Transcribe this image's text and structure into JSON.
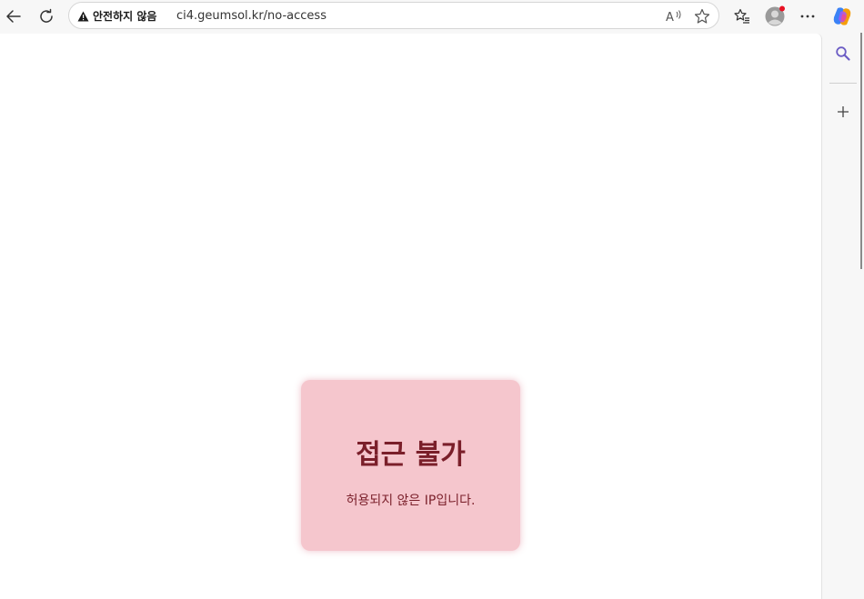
{
  "browser": {
    "security_label": "안전하지 않음",
    "url": "ci4.geumsol.kr/no-access",
    "icons": {
      "back": "back-arrow-icon",
      "refresh": "refresh-icon",
      "warning": "warning-triangle-icon",
      "read_aloud": "read-aloud-icon",
      "favorite": "star-icon",
      "favorites": "favorites-list-icon",
      "profile": "profile-avatar-icon",
      "more": "more-menu-icon",
      "copilot": "copilot-icon",
      "sidebar_search": "search-icon",
      "sidebar_add": "plus-icon"
    },
    "profile_notification_color": "#e81123"
  },
  "page": {
    "card": {
      "title": "접근 불가",
      "message": "허용되지 않은 IP입니다.",
      "background_color": "#f5c6cd",
      "text_color": "#7a1f2a"
    }
  }
}
